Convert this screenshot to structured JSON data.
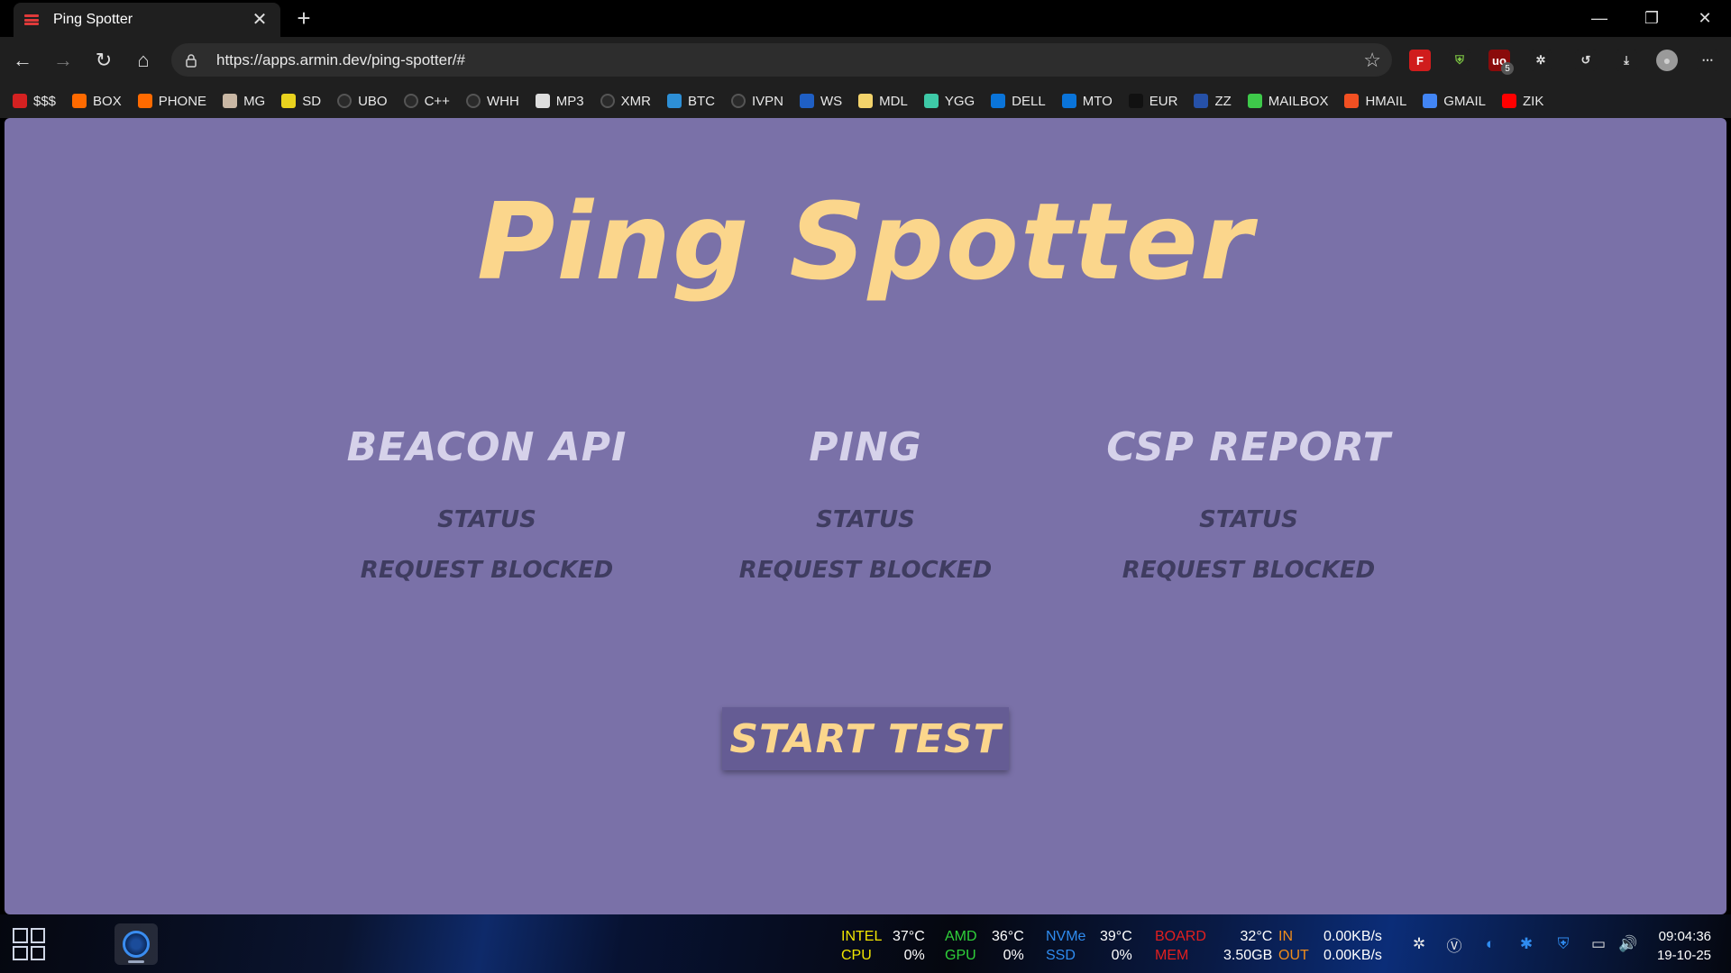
{
  "browser": {
    "tab_title": "Ping Spotter",
    "tab_close": "✕",
    "new_tab": "+",
    "url": "https://apps.armin.dev/ping-spotter/#",
    "window_controls": {
      "minimize": "—",
      "restore": "❐",
      "close": "✕"
    }
  },
  "toolbar": {
    "back": "←",
    "forward": "→",
    "reload": "↻",
    "home": "⌂",
    "star": "☆",
    "extensions": [
      {
        "name": "flashcard-icon",
        "glyph": "F",
        "bg": "#d01c1c",
        "fg": "#ffffff"
      },
      {
        "name": "shield-ext-icon",
        "glyph": "⛨",
        "bg": "#1f1f1f",
        "fg": "#7cc443"
      },
      {
        "name": "ublock-icon",
        "glyph": "uo",
        "bg": "#8a0b0b",
        "fg": "#ffffff",
        "badge": "5"
      },
      {
        "name": "puzzle-icon",
        "glyph": "✲",
        "bg": "#1f1f1f",
        "fg": "#dddddd"
      },
      {
        "name": "history-icon",
        "glyph": "↺",
        "bg": "#1f1f1f",
        "fg": "#dddddd"
      },
      {
        "name": "download-icon",
        "glyph": "⤓",
        "bg": "#1f1f1f",
        "fg": "#dddddd"
      },
      {
        "name": "profile-icon",
        "glyph": "●",
        "bg": "#9a9a9a",
        "fg": "#cfcfcf"
      },
      {
        "name": "menu-icon",
        "glyph": "⋯",
        "bg": "#1f1f1f",
        "fg": "#dddddd"
      }
    ]
  },
  "bookmarks": [
    {
      "label": "$$$",
      "color": "#d42121"
    },
    {
      "label": "BOX",
      "color": "#ff6a00"
    },
    {
      "label": "PHONE",
      "color": "#ff6a00"
    },
    {
      "label": "MG",
      "color": "#c9b7a4"
    },
    {
      "label": "SD",
      "color": "#e9d21e"
    },
    {
      "label": "UBO",
      "color": "#2a2a2a"
    },
    {
      "label": "C++",
      "color": "#2a2a2a"
    },
    {
      "label": "WHH",
      "color": "#2a2a2a"
    },
    {
      "label": "MP3",
      "color": "#dddddd"
    },
    {
      "label": "XMR",
      "color": "#2a2a2a"
    },
    {
      "label": "BTC",
      "color": "#2d8fd6"
    },
    {
      "label": "IVPN",
      "color": "#2a2a2a"
    },
    {
      "label": "WS",
      "color": "#1f5fc4"
    },
    {
      "label": "MDL",
      "color": "#f3d36b"
    },
    {
      "label": "YGG",
      "color": "#3ec9a7"
    },
    {
      "label": "DELL",
      "color": "#0a74d9"
    },
    {
      "label": "MTO",
      "color": "#0a74d9"
    },
    {
      "label": "EUR",
      "color": "#111111"
    },
    {
      "label": "ZZ",
      "color": "#2651a8"
    },
    {
      "label": "MAILBOX",
      "color": "#3ec94a"
    },
    {
      "label": "HMAIL",
      "color": "#f25022"
    },
    {
      "label": "GMAIL",
      "color": "#4285f4"
    },
    {
      "label": "ZIK",
      "color": "#ff0000"
    }
  ],
  "page": {
    "title": "Ping Spotter",
    "columns": [
      {
        "title": "Beacon API",
        "status_label": "Status",
        "result": "Request Blocked"
      },
      {
        "title": "Ping",
        "status_label": "Status",
        "result": "Request Blocked"
      },
      {
        "title": "CSP Report",
        "status_label": "Status",
        "result": "Request Blocked"
      }
    ],
    "start_button": "Start Test"
  },
  "taskbar": {
    "sensors": [
      {
        "top_label": "INTEL",
        "top_value": "37°C",
        "bottom_label": "CPU",
        "bottom_value": "0%",
        "label_color": "#f2e600",
        "bottom_color": "#f2e600"
      },
      {
        "top_label": "AMD",
        "top_value": "36°C",
        "bottom_label": "GPU",
        "bottom_value": "0%",
        "label_color": "#2fd13a",
        "bottom_color": "#2fd13a"
      },
      {
        "top_label": "NVMe",
        "top_value": "39°C",
        "bottom_label": "SSD",
        "bottom_value": "0%",
        "label_color": "#2f8cf0",
        "bottom_color": "#2f8cf0"
      },
      {
        "top_label": "BOARD",
        "top_value": "32°C",
        "bottom_label": "MEM",
        "bottom_value": "3.50GB",
        "label_color": "#e21f1f",
        "bottom_color": "#e21f1f"
      },
      {
        "top_label": "IN",
        "top_value": "0.00KB/s",
        "bottom_label": "OUT",
        "bottom_value": "0.00KB/s",
        "label_color": "#f08c1a",
        "bottom_color": "#f08c1a"
      }
    ],
    "tray": [
      "✲",
      "Ⓥ",
      "◐",
      "✱",
      "⛨",
      "▭",
      "🔊"
    ],
    "time": "09:04:36",
    "date": "19-10-25"
  }
}
